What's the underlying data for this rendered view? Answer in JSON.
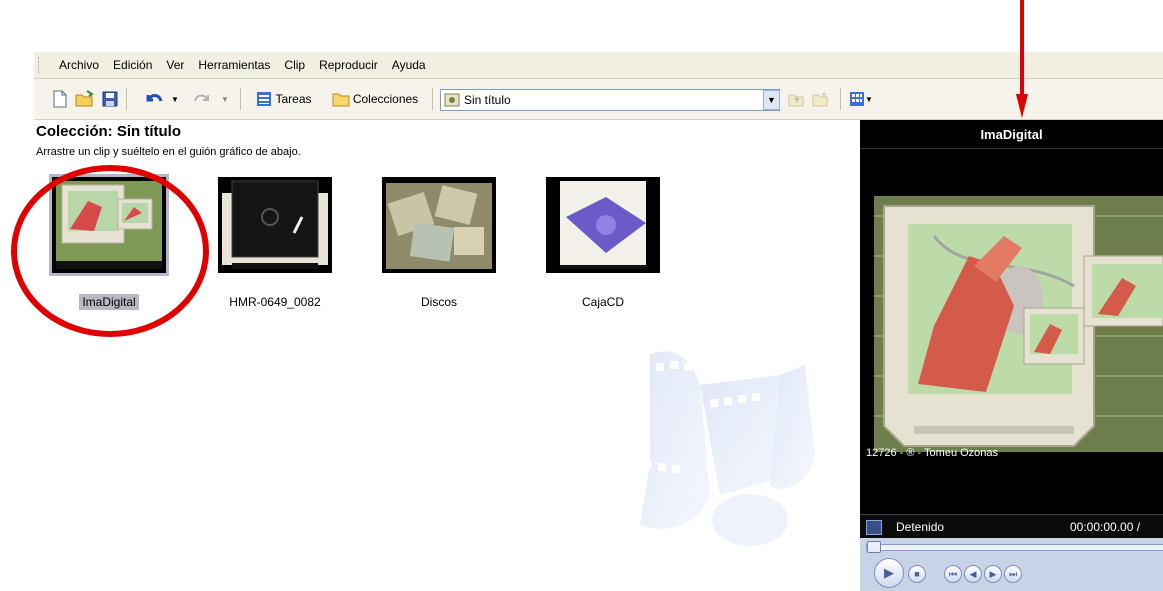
{
  "menu": [
    "Archivo",
    "Edición",
    "Ver",
    "Herramientas",
    "Clip",
    "Reproducir",
    "Ayuda"
  ],
  "toolbar": {
    "tasks_label": "Tareas",
    "collections_label": "Colecciones",
    "combo_value": "Sin título"
  },
  "collection": {
    "title": "Colección: Sin título",
    "hint": "Arrastre un clip y suéltelo en el guión gráfico de abajo."
  },
  "clips": [
    {
      "label": "ImaDigital",
      "selected": true
    },
    {
      "label": "HMR-0649_0082",
      "selected": false
    },
    {
      "label": "Discos",
      "selected": false
    },
    {
      "label": "CajaCD",
      "selected": false
    }
  ],
  "preview": {
    "title": "ImaDigital",
    "credit": "12726 - ® - Tomeu Ozonas",
    "status": "Detenido",
    "time": "00:00:00.00 /"
  },
  "colors": {
    "annotation_red": "#e00000",
    "monitor_bg": "#000000",
    "menu_bg": "#f1efe2"
  }
}
